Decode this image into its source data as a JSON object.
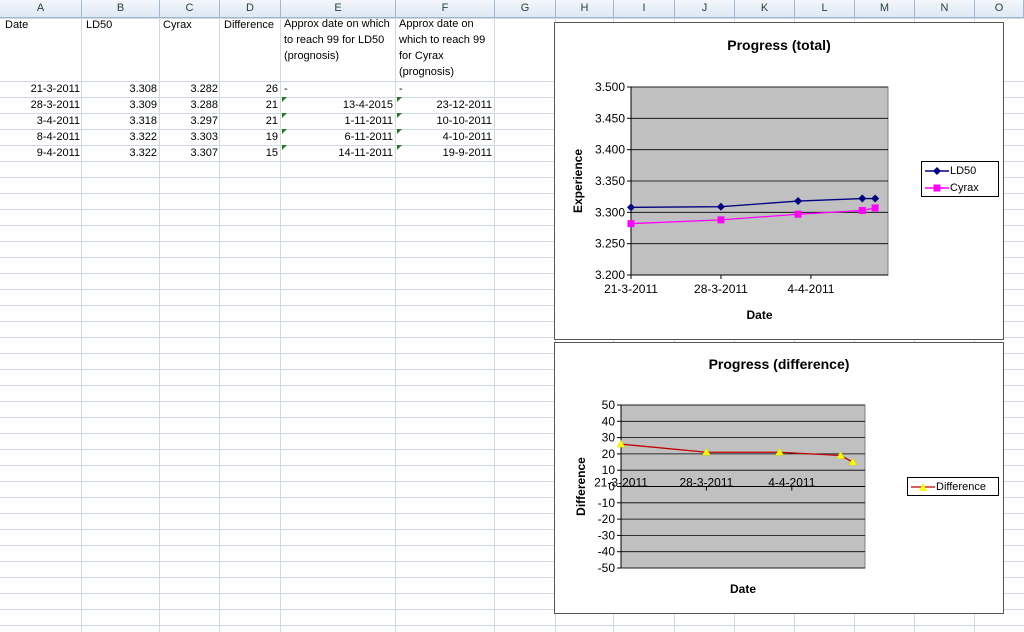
{
  "columns": [
    "A",
    "B",
    "C",
    "D",
    "E",
    "F",
    "G",
    "H",
    "I",
    "J",
    "K",
    "L",
    "M",
    "N",
    "O"
  ],
  "header_cells": {
    "date": "Date",
    "ld50": "LD50",
    "cyrax": "Cyrax",
    "difference": "Difference",
    "approx_ld50": "Approx date on which to reach 99 for LD50 (prognosis)",
    "approx_cyrax": "Approx date on which to reach 99 for Cyrax (prognosis)"
  },
  "rows": [
    {
      "date": "21-3-2011",
      "ld50": "3.308",
      "cyrax": "3.282",
      "difference": "26",
      "e": "-",
      "f": "-"
    },
    {
      "date": "28-3-2011",
      "ld50": "3.309",
      "cyrax": "3.288",
      "difference": "21",
      "e": "13-4-2015",
      "f": "23-12-2011"
    },
    {
      "date": "3-4-2011",
      "ld50": "3.318",
      "cyrax": "3.297",
      "difference": "21",
      "e": "1-11-2011",
      "f": "10-10-2011"
    },
    {
      "date": "8-4-2011",
      "ld50": "3.322",
      "cyrax": "3.303",
      "difference": "19",
      "e": "6-11-2011",
      "f": "4-10-2011"
    },
    {
      "date": "9-4-2011",
      "ld50": "3.322",
      "cyrax": "3.307",
      "difference": "15",
      "e": "14-11-2011",
      "f": "19-9-2011"
    }
  ],
  "chart_data": [
    {
      "type": "line",
      "title": "Progress (total)",
      "xlabel": "Date",
      "ylabel": "Experience",
      "x": [
        "21-3-2011",
        "28-3-2011",
        "3-4-2011",
        "8-4-2011",
        "9-4-2011"
      ],
      "x_tick_labels": [
        "21-3-2011",
        "28-3-2011",
        "4-4-2011"
      ],
      "ylim": [
        3.2,
        3.5
      ],
      "y_ticks": [
        "3.200",
        "3.250",
        "3.300",
        "3.350",
        "3.400",
        "3.450",
        "3.500"
      ],
      "grid": true,
      "legend_position": "right",
      "series": [
        {
          "name": "LD50",
          "values": [
            3.308,
            3.309,
            3.318,
            3.322,
            3.322
          ],
          "color": "#000080",
          "marker": "diamond"
        },
        {
          "name": "Cyrax",
          "values": [
            3.282,
            3.288,
            3.297,
            3.303,
            3.307
          ],
          "color": "#ff00ff",
          "marker": "square"
        }
      ]
    },
    {
      "type": "line",
      "title": "Progress (difference)",
      "xlabel": "Date",
      "ylabel": "Difference",
      "x": [
        "21-3-2011",
        "28-3-2011",
        "3-4-2011",
        "8-4-2011",
        "9-4-2011"
      ],
      "x_tick_labels": [
        "21-3-2011",
        "28-3-2011",
        "4-4-2011"
      ],
      "ylim": [
        -50,
        50
      ],
      "y_ticks": [
        "50",
        "40",
        "30",
        "20",
        "10",
        "0",
        "-10",
        "-20",
        "-30",
        "-40",
        "-50"
      ],
      "grid": true,
      "legend_position": "right",
      "series": [
        {
          "name": "Difference",
          "values": [
            26,
            21,
            21,
            19,
            15
          ],
          "color": "#c00000",
          "marker": "triangle",
          "marker_color": "#ffff00"
        }
      ]
    }
  ]
}
